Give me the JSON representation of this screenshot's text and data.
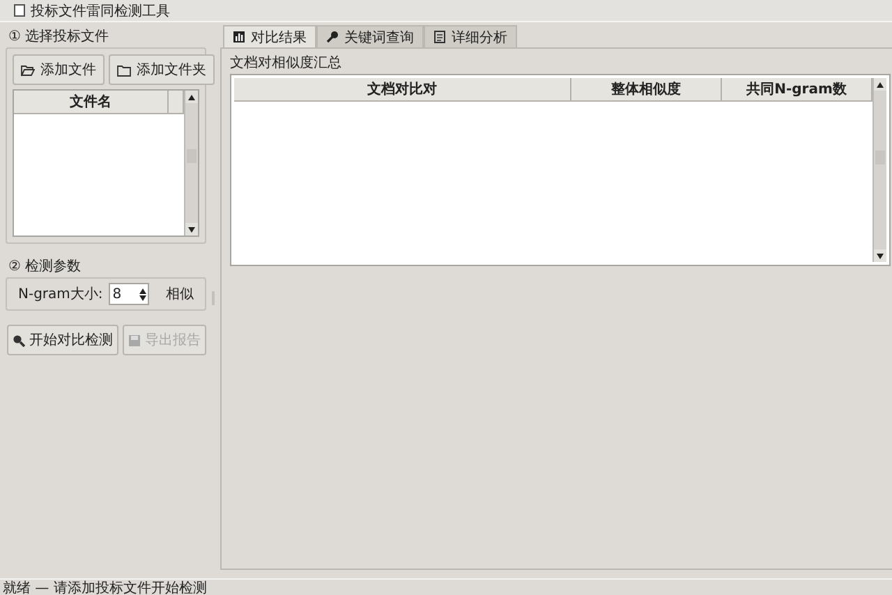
{
  "window": {
    "title": "投标文件雷同检测工具"
  },
  "file_section": {
    "title": "① 选择投标文件",
    "buttons": [
      {
        "label": "添加文件"
      },
      {
        "label": "添加文件夹"
      }
    ],
    "table": {
      "columns": [
        "文件名",
        ""
      ]
    }
  },
  "params_section": {
    "title": "② 检测参数",
    "ngram_label": "N-gram大小:",
    "ngram_value": "8",
    "similarity_label": "相似"
  },
  "actions": [
    {
      "label": "开始对比检测",
      "disabled": false
    },
    {
      "label": "导出报告",
      "disabled": true
    }
  ],
  "tabs": [
    {
      "label": "对比结果",
      "selected": true
    },
    {
      "label": "关键词查询",
      "selected": false
    },
    {
      "label": "详细分析",
      "selected": false
    }
  ],
  "results": {
    "title": "文档对相似度汇总",
    "columns": [
      "文档对比对",
      "整体相似度",
      "共同N-gram数"
    ]
  },
  "status_bar": "就绪 — 请添加投标文件开始检测"
}
